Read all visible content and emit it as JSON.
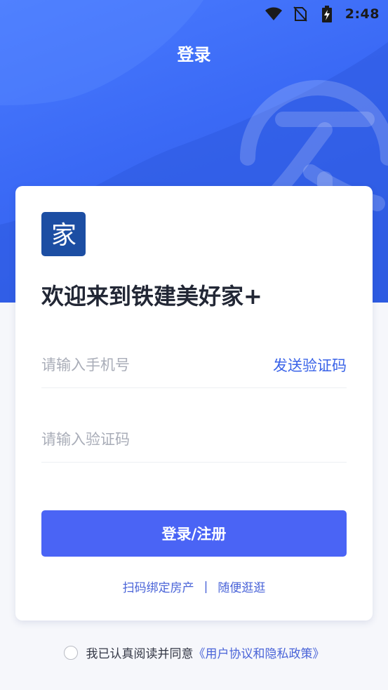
{
  "status_bar": {
    "time": "2:48",
    "icons": [
      "wifi-icon",
      "no-sim-icon",
      "battery-charging-icon"
    ]
  },
  "header": {
    "title": "登录"
  },
  "brand": {
    "logo_glyph": "家",
    "logo_color": "#1c4ea3",
    "accent_color": "#4a64f5"
  },
  "card": {
    "welcome": "欢迎来到铁建美好家+",
    "phone_placeholder": "请输入手机号",
    "phone_value": "",
    "send_code_label": "发送验证码",
    "code_placeholder": "请输入验证码",
    "code_value": "",
    "submit_label": "登录/注册",
    "link_scan": "扫码绑定房产",
    "link_separator": "|",
    "link_browse": "随便逛逛"
  },
  "agreement": {
    "text": "我已认真阅读并同意",
    "link": "《用户协议和隐私政策》",
    "checked": false
  }
}
